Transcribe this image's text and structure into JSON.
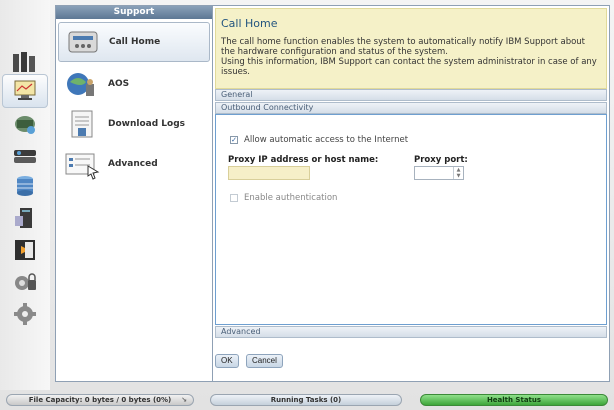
{
  "rail": {
    "icons": [
      "servers-icon",
      "monitoring-icon",
      "pools-icon",
      "volumes-icon",
      "copy-services-icon",
      "hosts-icon",
      "access-icon",
      "security-icon",
      "settings-icon"
    ]
  },
  "menu": {
    "header": "Support",
    "items": [
      {
        "label": "Call Home",
        "icon": "call-home-icon"
      },
      {
        "label": "AOS",
        "icon": "aos-icon"
      },
      {
        "label": "Download Logs",
        "icon": "download-logs-icon"
      },
      {
        "label": "Advanced",
        "icon": "advanced-icon"
      }
    ]
  },
  "main": {
    "title": "Call Home",
    "description": "The call home function enables the system to automatically notify IBM Support about the hardware configuration and status of the system.",
    "description2": "Using this information, IBM Support can contact the system administrator in case of any issues.",
    "general_label": "General",
    "outbound_label": "Outbound Connectivity",
    "allow_internet_label": "Allow automatic access to the Internet",
    "allow_internet_checked": true,
    "proxy_label": "Proxy IP address or host name:",
    "proxy_value": "",
    "port_label": "Proxy port:",
    "port_value": "",
    "enable_auth_label": "Enable authentication",
    "enable_auth_checked": false,
    "advanced_label": "Advanced",
    "ok_label": "OK",
    "cancel_label": "Cancel"
  },
  "status": {
    "capacity": "File Capacity: 0 bytes / 0 bytes (0%)",
    "tasks": "Running Tasks (0)",
    "health": "Health Status"
  },
  "colors": {
    "accent": "#23557f",
    "title_bg": "#f5f1c8",
    "health": "#3ea63a"
  }
}
